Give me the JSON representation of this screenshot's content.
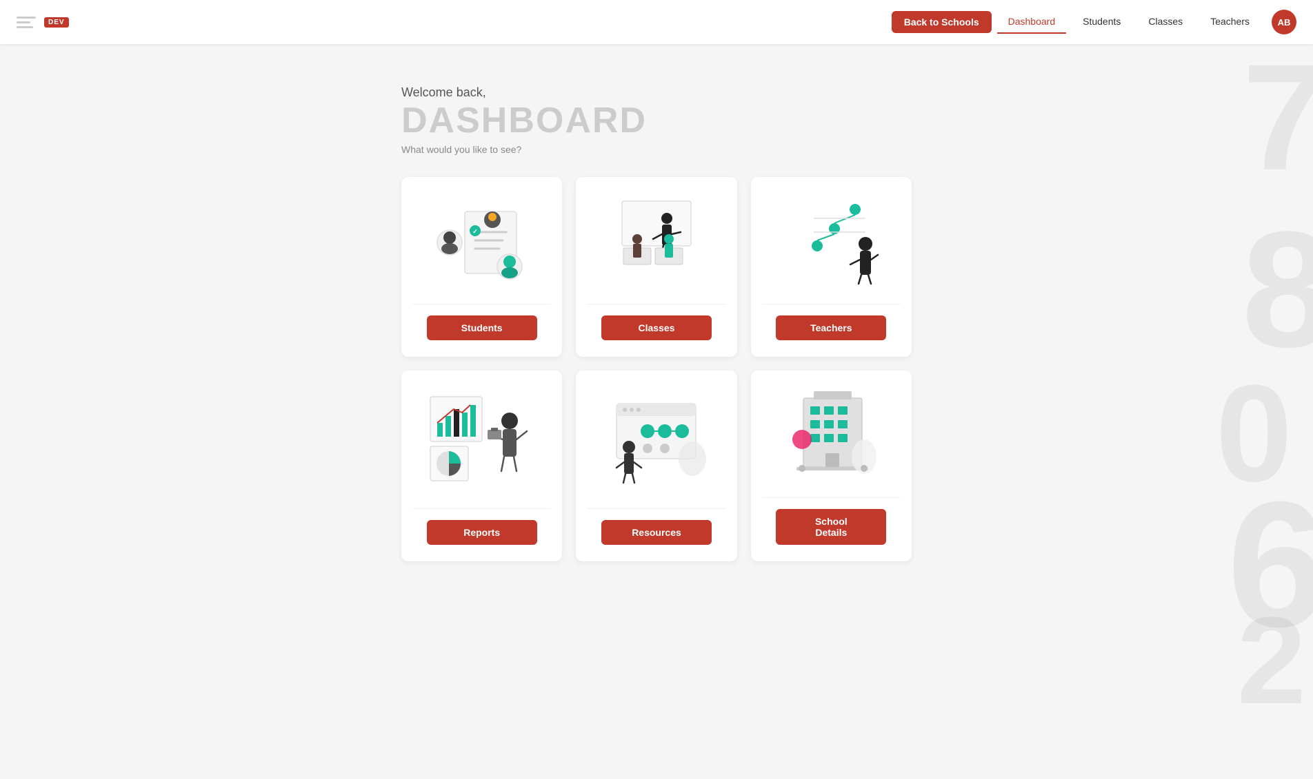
{
  "header": {
    "dev_badge": "DEV",
    "nav": {
      "back_button": "Back to Schools",
      "items": [
        {
          "label": "Dashboard",
          "active": true
        },
        {
          "label": "Students",
          "active": false
        },
        {
          "label": "Classes",
          "active": false
        },
        {
          "label": "Teachers",
          "active": false
        }
      ],
      "avatar_initials": "AB"
    }
  },
  "main": {
    "welcome": "Welcome back,",
    "title": "DASHBOARD",
    "subtitle": "What would you like to see?",
    "cards": [
      {
        "id": "students",
        "button_label": "Students"
      },
      {
        "id": "classes",
        "button_label": "Classes"
      },
      {
        "id": "teachers",
        "button_label": "Teachers"
      },
      {
        "id": "reports",
        "button_label": "Reports"
      },
      {
        "id": "resources",
        "button_label": "Resources"
      },
      {
        "id": "school",
        "button_label": "School Details"
      }
    ]
  },
  "bg_numbers": [
    "7",
    "8",
    "0",
    "6",
    "2"
  ]
}
